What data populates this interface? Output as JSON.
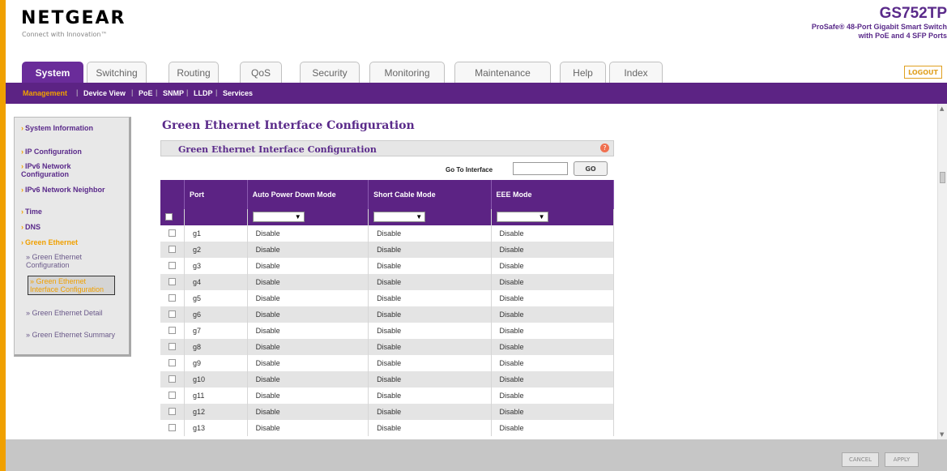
{
  "header": {
    "logo": "NETGEAR",
    "tagline": "Connect with Innovation™",
    "model": "GS752TP",
    "model_desc_1": "ProSafe® 48-Port Gigabit Smart Switch",
    "model_desc_2": "with PoE and 4 SFP Ports"
  },
  "tabs": [
    {
      "label": "System",
      "active": true
    },
    {
      "label": "Switching"
    },
    {
      "label": "Routing"
    },
    {
      "label": "QoS"
    },
    {
      "label": "Security"
    },
    {
      "label": "Monitoring"
    },
    {
      "label": "Maintenance"
    },
    {
      "label": "Help"
    },
    {
      "label": "Index"
    }
  ],
  "logout_label": "LOGOUT",
  "subnav": [
    {
      "label": "Management",
      "active": true
    },
    {
      "label": "Device View"
    },
    {
      "label": "PoE"
    },
    {
      "label": "SNMP"
    },
    {
      "label": "LLDP"
    },
    {
      "label": "Services"
    }
  ],
  "leftnav": {
    "system_information": "System Information",
    "ip_configuration": "IP Configuration",
    "ipv6_network_configuration": "IPv6 Network Configuration",
    "ipv6_network_neighbor": "IPv6 Network Neighbor",
    "time": "Time",
    "dns": "DNS",
    "green_ethernet": "Green Ethernet",
    "ge_configuration": "» Green Ethernet Configuration",
    "ge_interface_configuration": "» Green Ethernet Interface Configuration",
    "ge_detail": "» Green Ethernet Detail",
    "ge_summary": "» Green Ethernet Summary"
  },
  "page_title": "Green Ethernet Interface Configuration",
  "panel_title": "Green Ethernet Interface Configuration",
  "help_icon": "help-icon",
  "goto": {
    "label": "Go To Interface",
    "value": "",
    "button": "GO"
  },
  "table": {
    "columns": [
      "Port",
      "Auto Power Down Mode",
      "Short Cable Mode",
      "EEE Mode"
    ],
    "rows": [
      {
        "port": "g1",
        "apd": "Disable",
        "scm": "Disable",
        "eee": "Disable"
      },
      {
        "port": "g2",
        "apd": "Disable",
        "scm": "Disable",
        "eee": "Disable"
      },
      {
        "port": "g3",
        "apd": "Disable",
        "scm": "Disable",
        "eee": "Disable"
      },
      {
        "port": "g4",
        "apd": "Disable",
        "scm": "Disable",
        "eee": "Disable"
      },
      {
        "port": "g5",
        "apd": "Disable",
        "scm": "Disable",
        "eee": "Disable"
      },
      {
        "port": "g6",
        "apd": "Disable",
        "scm": "Disable",
        "eee": "Disable"
      },
      {
        "port": "g7",
        "apd": "Disable",
        "scm": "Disable",
        "eee": "Disable"
      },
      {
        "port": "g8",
        "apd": "Disable",
        "scm": "Disable",
        "eee": "Disable"
      },
      {
        "port": "g9",
        "apd": "Disable",
        "scm": "Disable",
        "eee": "Disable"
      },
      {
        "port": "g10",
        "apd": "Disable",
        "scm": "Disable",
        "eee": "Disable"
      },
      {
        "port": "g11",
        "apd": "Disable",
        "scm": "Disable",
        "eee": "Disable"
      },
      {
        "port": "g12",
        "apd": "Disable",
        "scm": "Disable",
        "eee": "Disable"
      },
      {
        "port": "g13",
        "apd": "Disable",
        "scm": "Disable",
        "eee": "Disable"
      }
    ]
  },
  "footer": {
    "cancel": "CANCEL",
    "apply": "APPLY"
  },
  "colors": {
    "purple": "#5c2384",
    "orange": "#f0a000"
  }
}
